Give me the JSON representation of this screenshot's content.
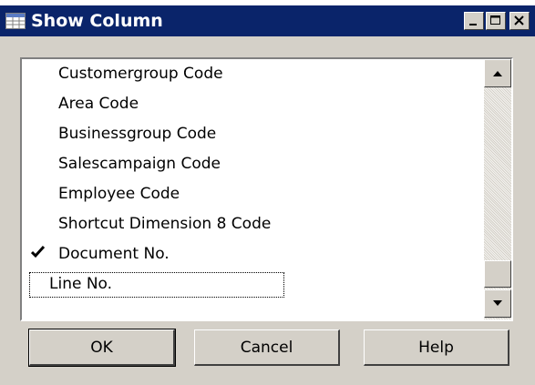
{
  "window": {
    "title": "Show Column",
    "minimize_glyph": "_",
    "maximize_glyph": "□",
    "close_glyph": "✕"
  },
  "list": {
    "items": [
      {
        "label": "Customergroup Code",
        "checked": false
      },
      {
        "label": "Area Code",
        "checked": false
      },
      {
        "label": "Businessgroup Code",
        "checked": false
      },
      {
        "label": "Salescampaign Code",
        "checked": false
      },
      {
        "label": "Employee Code",
        "checked": false
      },
      {
        "label": "Shortcut Dimension 8 Code",
        "checked": false
      },
      {
        "label": "Document No.",
        "checked": true
      },
      {
        "label": "Line No.",
        "checked": false
      }
    ],
    "focused_item": "Line No."
  },
  "buttons": {
    "ok_label": "OK",
    "cancel_label": "Cancel",
    "help_label": "Help"
  },
  "colors": {
    "title_bar": "#0a246a",
    "face": "#d4d0c8"
  },
  "icons": {
    "app": "table-icon",
    "check": "check-mark-icon"
  }
}
